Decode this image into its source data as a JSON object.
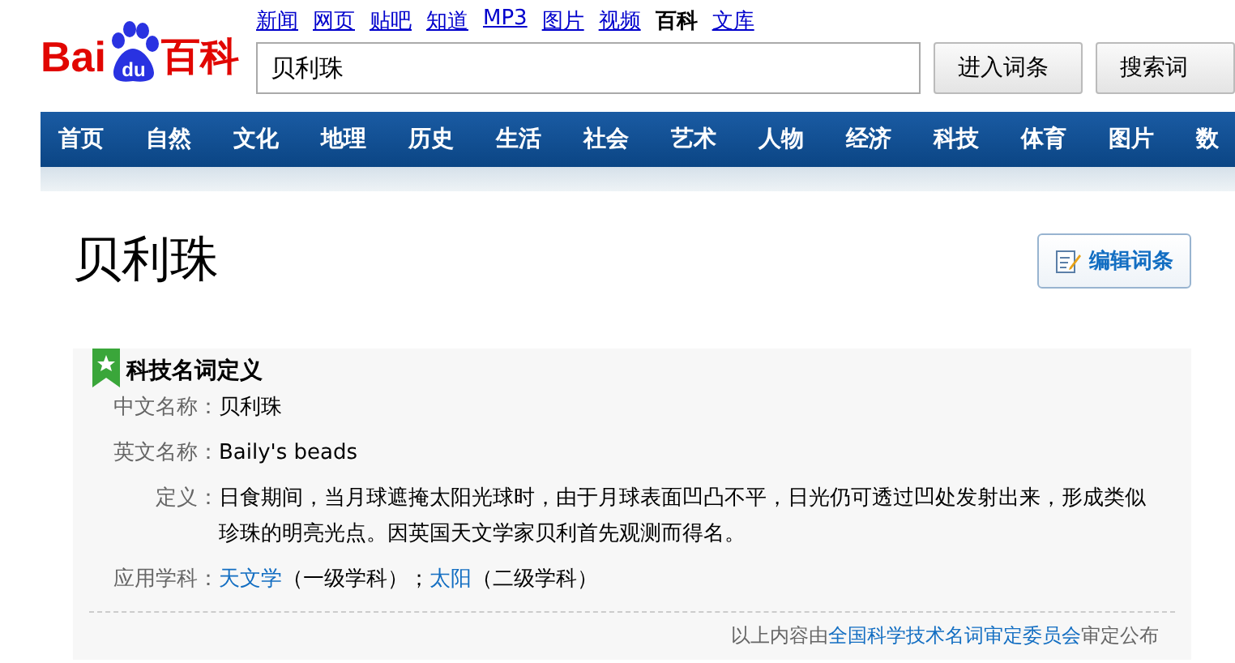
{
  "logo": {
    "prefix": "Bai",
    "paw": "du",
    "suffix": "百科"
  },
  "top_links": [
    {
      "label": "新闻",
      "selected": false
    },
    {
      "label": "网页",
      "selected": false
    },
    {
      "label": "贴吧",
      "selected": false
    },
    {
      "label": "知道",
      "selected": false
    },
    {
      "label": "MP3",
      "selected": false
    },
    {
      "label": "图片",
      "selected": false
    },
    {
      "label": "视频",
      "selected": false
    },
    {
      "label": "百科",
      "selected": true
    },
    {
      "label": "文库",
      "selected": false
    }
  ],
  "search": {
    "value": "贝利珠",
    "buttons": [
      "进入词条",
      "搜索词"
    ]
  },
  "nav": [
    "首页",
    "自然",
    "文化",
    "地理",
    "历史",
    "生活",
    "社会",
    "艺术",
    "人物",
    "经济",
    "科技",
    "体育",
    "图片",
    "数"
  ],
  "page_title": "贝利珠",
  "edit_button": "编辑词条",
  "card": {
    "title": "科技名词定义",
    "rows": [
      {
        "label": "中文名称：",
        "parts": [
          {
            "kind": "text",
            "text": "贝利珠"
          }
        ]
      },
      {
        "label": "英文名称：",
        "parts": [
          {
            "kind": "text",
            "text": "Baily's beads"
          }
        ]
      },
      {
        "label": "定义：",
        "parts": [
          {
            "kind": "text",
            "text": "日食期间，当月球遮掩太阳光球时，由于月球表面凹凸不平，日光仍可透过凹处发射出来，形成类似珍珠的明亮光点。因英国天文学家贝利首先观测而得名。"
          }
        ]
      },
      {
        "label": "应用学科：",
        "parts": [
          {
            "kind": "link",
            "text": "天文学"
          },
          {
            "kind": "text",
            "text": "（一级学科）；"
          },
          {
            "kind": "link",
            "text": "太阳"
          },
          {
            "kind": "text",
            "text": "（二级学科）"
          }
        ]
      }
    ],
    "footer": [
      {
        "kind": "text",
        "text": "以上内容由"
      },
      {
        "kind": "link",
        "text": "全国科学技术名词审定委员会"
      },
      {
        "kind": "text",
        "text": "审定公布"
      }
    ]
  }
}
